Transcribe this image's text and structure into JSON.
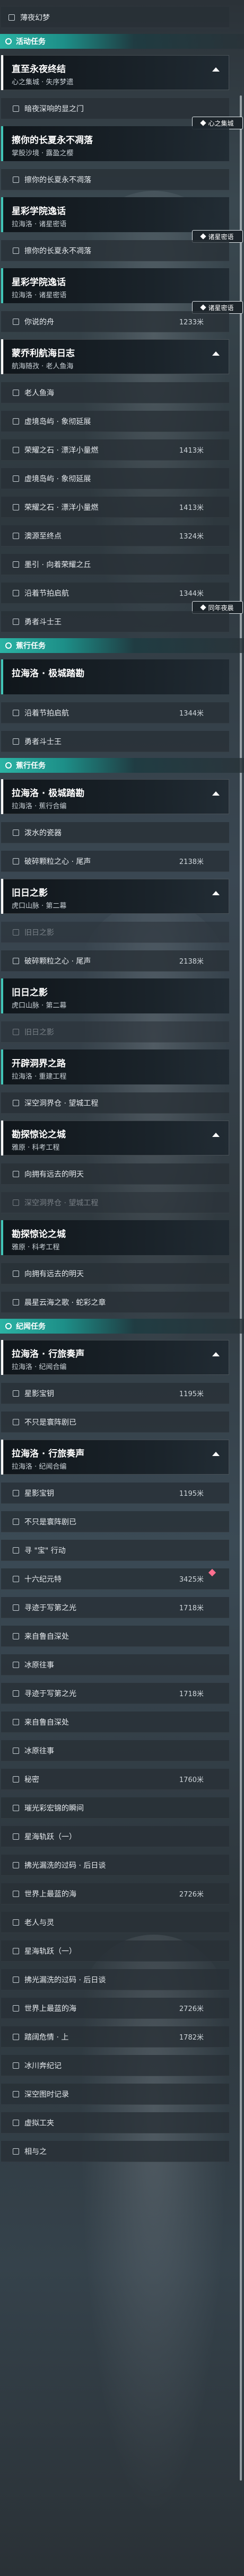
{
  "rows": [
    {
      "kind": "sub",
      "label": "薄夜幻梦",
      "flat": true
    },
    {
      "kind": "cat",
      "label": "活动任务"
    },
    {
      "kind": "header",
      "title": "直至永夜终结",
      "subtitle": "心之集城 · 失序梦遗",
      "caret": true
    },
    {
      "kind": "sub",
      "label": "暗夜深响的显之门",
      "badge": "心之集城"
    },
    {
      "kind": "header",
      "title": "擦你的长夏永不凋落",
      "subtitle": "掌股沙境 · 露盈之樱"
    },
    {
      "kind": "sub",
      "label": "擦你的长夏永不凋落"
    },
    {
      "kind": "header",
      "title": "星彩学院逸话",
      "subtitle": "拉海洛 · 诸星密语",
      "badge": "诸星密语"
    },
    {
      "kind": "sub",
      "label": "擦你的长夏永不凋落"
    },
    {
      "kind": "header",
      "title": "星彩学院逸话",
      "subtitle": "拉海洛 · 诸星密语",
      "badge": "诸星密语"
    },
    {
      "kind": "sub",
      "label": "你说的舟",
      "dist": "1233米"
    },
    {
      "kind": "header",
      "title": "蒙乔利航海日志",
      "subtitle": "航海随孜 · 老人鱼海",
      "caret": true
    },
    {
      "kind": "sub",
      "label": "老人鱼海"
    },
    {
      "kind": "sub",
      "label": "虚境岛屿 · 象彻延展"
    },
    {
      "kind": "sub",
      "label": "荣耀之石 · 漂洋小量燃",
      "dist": "1413米"
    },
    {
      "kind": "sub",
      "label": "虚境岛屿 · 象彻延展"
    },
    {
      "kind": "sub",
      "label": "荣耀之石 · 漂洋小量燃",
      "dist": "1413米"
    },
    {
      "kind": "sub",
      "label": "澳源至终点",
      "dist": "1324米"
    },
    {
      "kind": "sub",
      "label": "墨引 · 向着荣耀之丘"
    },
    {
      "kind": "sub",
      "label": "沿着节拍启航",
      "dist": "1344米",
      "badge": "同年夜晨"
    },
    {
      "kind": "sub",
      "label": "勇者斗士王"
    },
    {
      "kind": "cat",
      "label": "蕉行任务"
    },
    {
      "kind": "header",
      "title": "拉海洛 · 极城踏勘",
      "subtitle": ""
    },
    {
      "kind": "sub",
      "label": "沿着节拍启航",
      "dist": "1344米"
    },
    {
      "kind": "sub",
      "label": "勇者斗士王"
    },
    {
      "kind": "cat",
      "label": "蕉行任务"
    },
    {
      "kind": "header",
      "title": "拉海洛 · 极城踏勘",
      "subtitle": "拉海洛 · 蕉行合编",
      "caret": true
    },
    {
      "kind": "sub",
      "label": "泼水的瓷器"
    },
    {
      "kind": "sub",
      "label": "破碎颗粒之心 · 尾声",
      "dist": "2138米"
    },
    {
      "kind": "header",
      "title": "旧日之影",
      "subtitle": "虎口山脉 · 第二幕",
      "caret": true
    },
    {
      "kind": "sub",
      "label": "旧日之影",
      "dim": true
    },
    {
      "kind": "sub",
      "label": "破碎颗粒之心 · 尾声",
      "dist": "2138米"
    },
    {
      "kind": "header",
      "title": "旧日之影",
      "subtitle": "虎口山脉 · 第二幕"
    },
    {
      "kind": "sub",
      "label": "旧日之影",
      "dim": true
    },
    {
      "kind": "header",
      "title": "开辟洞界之路",
      "subtitle": "拉海洛 · 重建工程"
    },
    {
      "kind": "sub",
      "label": "深空洞界仓 · 望城工程"
    },
    {
      "kind": "header",
      "title": "勘探惊论之城",
      "subtitle": "雅原 · 科考工程",
      "caret": true
    },
    {
      "kind": "sub",
      "label": "向拥有远去的明天"
    },
    {
      "kind": "sub",
      "label": "深空洞界仓 · 望城工程",
      "dim": true
    },
    {
      "kind": "header",
      "title": "勘探惊论之城",
      "subtitle": "雅原 · 科考工程"
    },
    {
      "kind": "sub",
      "label": "向拥有远去的明天"
    },
    {
      "kind": "sub",
      "label": "晨星云海之歌 · 蛇彩之章"
    },
    {
      "kind": "cat",
      "label": "纪闻任务"
    },
    {
      "kind": "header",
      "title": "拉海洛 · 行旅奏声",
      "subtitle": "拉海洛 · 纪闻合编",
      "caret": true
    },
    {
      "kind": "sub",
      "label": "星影宝钥",
      "dist": "1195米"
    },
    {
      "kind": "sub",
      "label": "不只是寰阵剧已"
    },
    {
      "kind": "header",
      "title": "拉海洛 · 行旅奏声",
      "subtitle": "拉海洛 · 纪闻合编",
      "caret": true
    },
    {
      "kind": "sub",
      "label": "星影宝钥",
      "dist": "1195米"
    },
    {
      "kind": "sub",
      "label": "不只是寰阵剧已"
    },
    {
      "kind": "sub",
      "label": "寻 \"宝\" 行动"
    },
    {
      "kind": "sub",
      "label": "十六纪元特",
      "dist": "3425米",
      "marker": true
    },
    {
      "kind": "sub",
      "label": "寻迹于写第之光",
      "dist": "1718米"
    },
    {
      "kind": "sub",
      "label": "来自鲁自深处"
    },
    {
      "kind": "sub",
      "label": "冰原往事"
    },
    {
      "kind": "sub",
      "label": "寻迹于写第之光",
      "dist": "1718米"
    },
    {
      "kind": "sub",
      "label": "来自鲁自深处"
    },
    {
      "kind": "sub",
      "label": "冰原往事"
    },
    {
      "kind": "sub",
      "label": "秘密",
      "dist": "1760米"
    },
    {
      "kind": "sub",
      "label": "璀光彩宏锦的瞬间"
    },
    {
      "kind": "sub",
      "label": "星海轨跃（一）"
    },
    {
      "kind": "sub",
      "label": "拂光漏洗的过码 · 后日谈"
    },
    {
      "kind": "sub",
      "label": "世界上最蓝的海",
      "dist": "2726米"
    },
    {
      "kind": "sub",
      "label": "老人与灵"
    },
    {
      "kind": "sub",
      "label": "星海轨跃（一）"
    },
    {
      "kind": "sub",
      "label": "拂光漏洗的过码 · 后日谈"
    },
    {
      "kind": "sub",
      "label": "世界上最蓝的海",
      "dist": "2726米"
    },
    {
      "kind": "sub",
      "label": "踏阔危情 · 上",
      "dist": "1782米"
    },
    {
      "kind": "sub",
      "label": "冰川奔纪记"
    },
    {
      "kind": "sub",
      "label": "深空图时记录"
    },
    {
      "kind": "sub",
      "label": "虚拟工夹"
    },
    {
      "kind": "sub",
      "label": "相与之"
    }
  ]
}
